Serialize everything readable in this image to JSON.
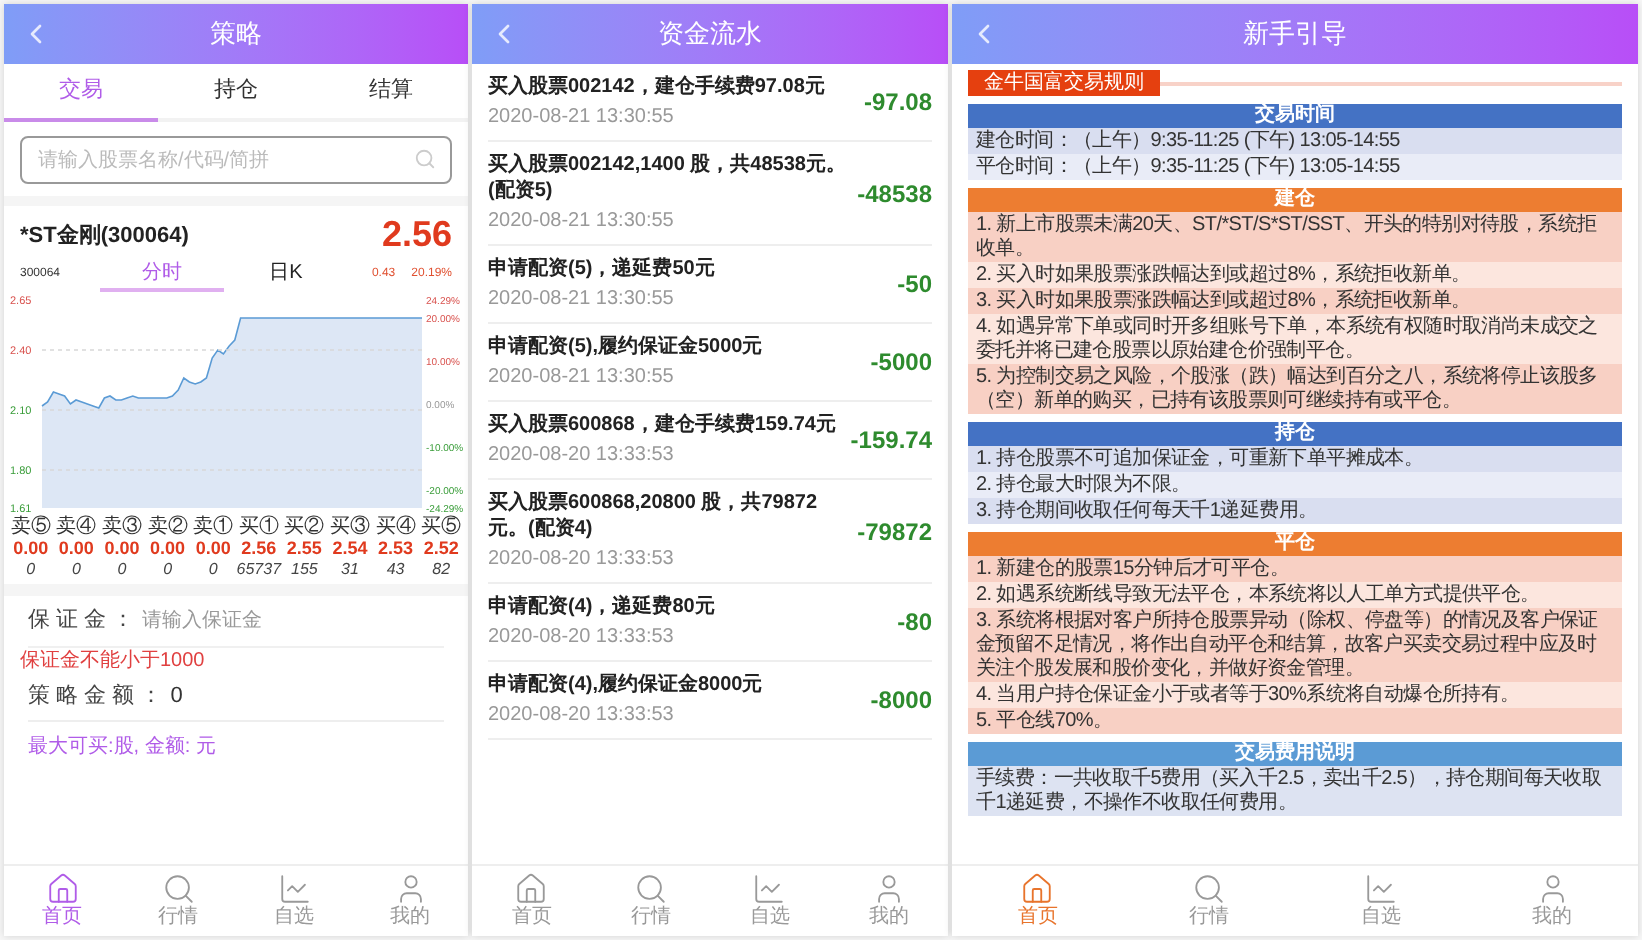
{
  "strategy": {
    "title": "策略",
    "tabs": [
      {
        "label": "交易",
        "selected": true
      },
      {
        "label": "持仓",
        "selected": false
      },
      {
        "label": "结算",
        "selected": false
      }
    ],
    "search": {
      "placeholder": "请输入股票名称/代码/简拼"
    },
    "stock": {
      "name": "*ST金刚(300064)",
      "price": "2.56",
      "code": "300064",
      "change": "0.43",
      "change_pct": "20.19%",
      "chart_tabs": [
        {
          "label": "分时",
          "selected": true
        },
        {
          "label": "日K",
          "selected": false
        }
      ],
      "percent_ticks": [
        "24.29%",
        "20.00%",
        "10.00%",
        "0.00%",
        "-10.00%",
        "-20.00%",
        "-24.29%"
      ],
      "chart_data": {
        "type": "area",
        "grid": true,
        "ylim": [
          1.61,
          2.65
        ],
        "yticks": [
          {
            "value": 2.65,
            "label": "2.65"
          },
          {
            "value": 2.4,
            "label": "2.40"
          },
          {
            "value": 2.1,
            "label": "2.10"
          },
          {
            "value": 1.8,
            "label": "1.80"
          },
          {
            "value": 1.61,
            "label": "1.61"
          }
        ],
        "series": [
          {
            "color": "#5b9bd5",
            "values": [
              2.12,
              2.14,
              2.19,
              2.18,
              2.17,
              2.13,
              2.15,
              2.14,
              2.13,
              2.12,
              2.11,
              2.16,
              2.17,
              2.15,
              2.15,
              2.16,
              2.17,
              2.16,
              2.16,
              2.16,
              2.16,
              2.16,
              2.16,
              2.17,
              2.2,
              2.26,
              2.24,
              2.23,
              2.24,
              2.26,
              2.36,
              2.4,
              2.38,
              2.42,
              2.45,
              2.56,
              2.56,
              2.56,
              2.56,
              2.56,
              2.56,
              2.56,
              2.56,
              2.56,
              2.56,
              2.56,
              2.56,
              2.56,
              2.56,
              2.56,
              2.56,
              2.56,
              2.56,
              2.56,
              2.56,
              2.56,
              2.56,
              2.56,
              2.56,
              2.56,
              2.56,
              2.56,
              2.56,
              2.56,
              2.56,
              2.56,
              2.56,
              2.56
            ]
          }
        ]
      }
    },
    "order_book": [
      {
        "label": "卖⑤",
        "price": "0.00",
        "volume": "0"
      },
      {
        "label": "卖④",
        "price": "0.00",
        "volume": "0"
      },
      {
        "label": "卖③",
        "price": "0.00",
        "volume": "0"
      },
      {
        "label": "卖②",
        "price": "0.00",
        "volume": "0"
      },
      {
        "label": "卖①",
        "price": "0.00",
        "volume": "0"
      },
      {
        "label": "买①",
        "price": "2.56",
        "volume": "65737"
      },
      {
        "label": "买②",
        "price": "2.55",
        "volume": "155"
      },
      {
        "label": "买③",
        "price": "2.54",
        "volume": "31"
      },
      {
        "label": "买④",
        "price": "2.53",
        "volume": "43"
      },
      {
        "label": "买⑤",
        "price": "2.52",
        "volume": "82"
      }
    ],
    "form": {
      "margin_label": "保 证 金 ：",
      "margin_placeholder": "请输入保证金",
      "margin_error": "保证金不能小于1000",
      "amount_label": "策 略 金 额 ：",
      "amount_value": "0",
      "max_buy": "最大可买:股, 金额: 元"
    },
    "nav": [
      {
        "label": "首页",
        "selected": true
      },
      {
        "label": "行情",
        "selected": false
      },
      {
        "label": "自选",
        "selected": false
      },
      {
        "label": "我的",
        "selected": false
      }
    ]
  },
  "fund_flow": {
    "title": "资金流水",
    "records": [
      {
        "description": "买入股票002142，建仓手续费97.08元",
        "time": "2020-08-21 13:30:55",
        "amount": "-97.08"
      },
      {
        "description": "买入股票002142,1400 股，共48538元。(配资5)",
        "time": "2020-08-21 13:30:55",
        "amount": "-48538"
      },
      {
        "description": "申请配资(5)，递延费50元",
        "time": "2020-08-21 13:30:55",
        "amount": "-50"
      },
      {
        "description": "申请配资(5),履约保证金5000元",
        "time": "2020-08-21 13:30:55",
        "amount": "-5000"
      },
      {
        "description": "买入股票600868，建仓手续费159.74元",
        "time": "2020-08-20 13:33:53",
        "amount": "-159.74"
      },
      {
        "description": "买入股票600868,20800 股，共79872元。(配资4)",
        "time": "2020-08-20 13:33:53",
        "amount": "-79872"
      },
      {
        "description": "申请配资(4)，递延费80元",
        "time": "2020-08-20 13:33:53",
        "amount": "-80"
      },
      {
        "description": "申请配资(4),履约保证金8000元",
        "time": "2020-08-20 13:33:53",
        "amount": "-8000"
      }
    ],
    "nav": [
      {
        "label": "首页",
        "selected": false
      },
      {
        "label": "行情",
        "selected": false
      },
      {
        "label": "自选",
        "selected": false
      },
      {
        "label": "我的",
        "selected": false
      }
    ]
  },
  "guide": {
    "title": "新手引导",
    "heading": "金牛国富交易规则",
    "sections": [
      {
        "title": "交易时间",
        "color": "#4472c4",
        "kind": "info",
        "rows": [
          "建仓时间：（上午）9:35-11:25 (下午) 13:05-14:55",
          "平仓时间：（上午）9:35-11:25 (下午) 13:05-14:55"
        ]
      },
      {
        "title": "建仓",
        "color": "#ed7d31",
        "kind": "rule",
        "rows": [
          "1. 新上市股票未满20天、ST/*ST/S*ST/SST、开头的特别对待股，系统拒收单。",
          "2. 买入时如果股票涨跌幅达到或超过8%，系统拒收新单。",
          "3. 买入时如果股票涨跌幅达到或超过8%，系统拒收新单。",
          "4. 如遇异常下单或同时开多组账号下单，本系统有权随时取消尚未成交之委托并将已建仓股票以原始建仓价强制平仓。",
          "5. 为控制交易之风险，个股涨（跌）幅达到百分之八，系统将停止该股多（空）新单的购买，已持有该股票则可继续持有或平仓。"
        ]
      },
      {
        "title": "持仓",
        "color": "#4472c4",
        "kind": "info",
        "rows": [
          "1. 持仓股票不可追加保证金，可重新下单平摊成本。",
          "2. 持仓最大时限为不限。",
          "3. 持仓期间收取任何每天千1递延费用。"
        ]
      },
      {
        "title": "平仓",
        "color": "#ed7d31",
        "kind": "rule",
        "rows": [
          "1. 新建仓的股票15分钟后才可平仓。",
          "2. 如遇系统断线导致无法平仓，本系统将以人工单方式提供平仓。",
          "3. 系统将根据对客户所持仓股票异动（除权、停盘等）的情况及客户保证金预留不足情况，将作出自动平仓和结算，故客户买卖交易过程中应及时关注个股发展和股价变化，并做好资金管理。",
          "4. 当用户持仓保证金小于或者等于30%系统将自动爆仓所持有。",
          "5. 平仓线70%。"
        ]
      },
      {
        "title": "交易费用说明",
        "color": "#5b9bd5",
        "kind": "note",
        "rows": [
          "手续费：一共收取千5费用（买入千2.5，卖出千2.5），持仓期间每天收取千1递延费，不操作不收取任何费用。"
        ]
      }
    ],
    "nav": [
      {
        "label": "首页",
        "selected": true
      },
      {
        "label": "行情",
        "selected": false
      },
      {
        "label": "自选",
        "selected": false
      },
      {
        "label": "我的",
        "selected": false
      }
    ]
  }
}
